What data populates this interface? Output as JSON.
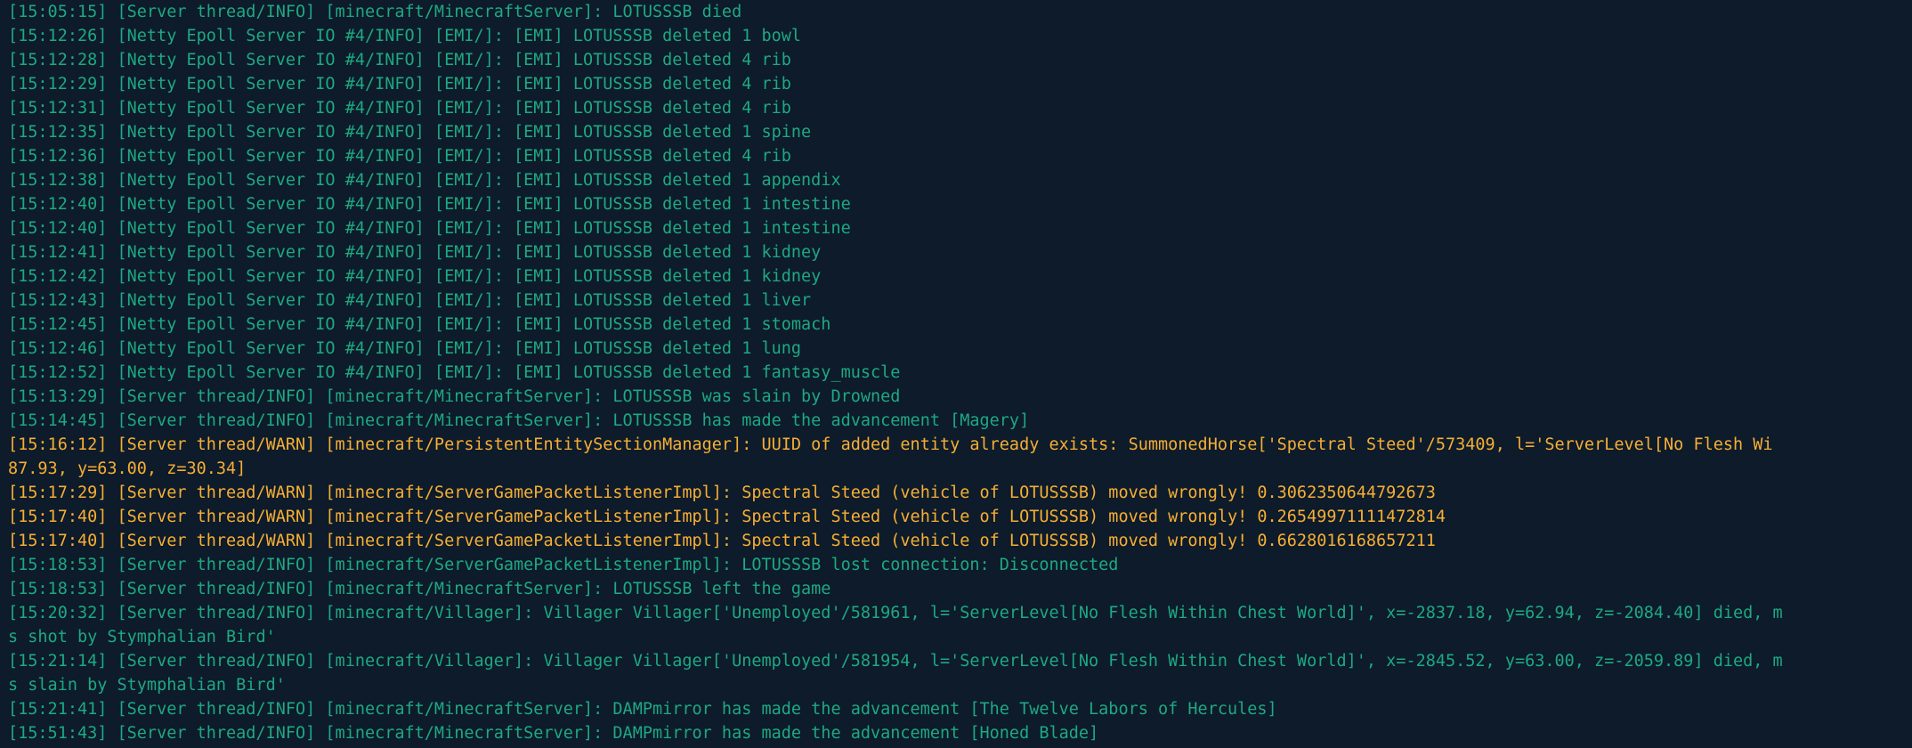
{
  "theme": {
    "background": "#0d1b2a",
    "info_color": "#1ea883",
    "warn_color": "#f6ae35"
  },
  "log": [
    {
      "level": "info",
      "text": "[15:05:15] [Server thread/INFO] [minecraft/MinecraftServer]: LOTUSSSB died"
    },
    {
      "level": "info",
      "text": "[15:12:26] [Netty Epoll Server IO #4/INFO] [EMI/]: [EMI] LOTUSSSB deleted 1 bowl"
    },
    {
      "level": "info",
      "text": "[15:12:28] [Netty Epoll Server IO #4/INFO] [EMI/]: [EMI] LOTUSSSB deleted 4 rib"
    },
    {
      "level": "info",
      "text": "[15:12:29] [Netty Epoll Server IO #4/INFO] [EMI/]: [EMI] LOTUSSSB deleted 4 rib"
    },
    {
      "level": "info",
      "text": "[15:12:31] [Netty Epoll Server IO #4/INFO] [EMI/]: [EMI] LOTUSSSB deleted 4 rib"
    },
    {
      "level": "info",
      "text": "[15:12:35] [Netty Epoll Server IO #4/INFO] [EMI/]: [EMI] LOTUSSSB deleted 1 spine"
    },
    {
      "level": "info",
      "text": "[15:12:36] [Netty Epoll Server IO #4/INFO] [EMI/]: [EMI] LOTUSSSB deleted 4 rib"
    },
    {
      "level": "info",
      "text": "[15:12:38] [Netty Epoll Server IO #4/INFO] [EMI/]: [EMI] LOTUSSSB deleted 1 appendix"
    },
    {
      "level": "info",
      "text": "[15:12:40] [Netty Epoll Server IO #4/INFO] [EMI/]: [EMI] LOTUSSSB deleted 1 intestine"
    },
    {
      "level": "info",
      "text": "[15:12:40] [Netty Epoll Server IO #4/INFO] [EMI/]: [EMI] LOTUSSSB deleted 1 intestine"
    },
    {
      "level": "info",
      "text": "[15:12:41] [Netty Epoll Server IO #4/INFO] [EMI/]: [EMI] LOTUSSSB deleted 1 kidney"
    },
    {
      "level": "info",
      "text": "[15:12:42] [Netty Epoll Server IO #4/INFO] [EMI/]: [EMI] LOTUSSSB deleted 1 kidney"
    },
    {
      "level": "info",
      "text": "[15:12:43] [Netty Epoll Server IO #4/INFO] [EMI/]: [EMI] LOTUSSSB deleted 1 liver"
    },
    {
      "level": "info",
      "text": "[15:12:45] [Netty Epoll Server IO #4/INFO] [EMI/]: [EMI] LOTUSSSB deleted 1 stomach"
    },
    {
      "level": "info",
      "text": "[15:12:46] [Netty Epoll Server IO #4/INFO] [EMI/]: [EMI] LOTUSSSB deleted 1 lung"
    },
    {
      "level": "info",
      "text": "[15:12:52] [Netty Epoll Server IO #4/INFO] [EMI/]: [EMI] LOTUSSSB deleted 1 fantasy_muscle"
    },
    {
      "level": "info",
      "text": "[15:13:29] [Server thread/INFO] [minecraft/MinecraftServer]: LOTUSSSB was slain by Drowned"
    },
    {
      "level": "info",
      "text": "[15:14:45] [Server thread/INFO] [minecraft/MinecraftServer]: LOTUSSSB has made the advancement [Magery]"
    },
    {
      "level": "warn",
      "text": "[15:16:12] [Server thread/WARN] [minecraft/PersistentEntitySectionManager]: UUID of added entity already exists: SummonedHorse['Spectral Steed'/573409, l='ServerLevel[No Flesh Wi"
    },
    {
      "level": "warn",
      "text": "87.93, y=63.00, z=30.34]"
    },
    {
      "level": "warn",
      "text": "[15:17:29] [Server thread/WARN] [minecraft/ServerGamePacketListenerImpl]: Spectral Steed (vehicle of LOTUSSSB) moved wrongly! 0.30623506447 92673"
    },
    {
      "level": "warn",
      "text": "[15:17:40] [Server thread/WARN] [minecraft/ServerGamePacketListenerImpl]: Spectral Steed (vehicle of LOTUSSSB) moved wrongly! 0.26549971111472814"
    },
    {
      "level": "warn",
      "text": "[15:17:40] [Server thread/WARN] [minecraft/ServerGamePacketListenerImpl]: Spectral Steed (vehicle of LOTUSSSB) moved wrongly! 0.6628016168657211"
    },
    {
      "level": "info",
      "text": "[15:18:53] [Server thread/INFO] [minecraft/ServerGamePacketListenerImpl]: LOTUSSSB lost connection: Disconnected"
    },
    {
      "level": "info",
      "text": "[15:18:53] [Server thread/INFO] [minecraft/MinecraftServer]: LOTUSSSB left the game"
    },
    {
      "level": "info",
      "text": "[15:20:32] [Server thread/INFO] [minecraft/Villager]: Villager Villager['Unemployed'/581961, l='ServerLevel[No Flesh Within Chest World]', x=-2837.18, y=62.94, z=-2084.40] died, m"
    },
    {
      "level": "info",
      "text": "s shot by Stymphalian Bird'"
    },
    {
      "level": "info",
      "text": "[15:21:14] [Server thread/INFO] [minecraft/Villager]: Villager Villager['Unemployed'/581954, l='ServerLevel[No Flesh Within Chest World]', x=-2845.52, y=63.00, z=-2059.89] died, m"
    },
    {
      "level": "info",
      "text": "s slain by Stymphalian Bird'"
    },
    {
      "level": "info",
      "text": "[15:21:41] [Server thread/INFO] [minecraft/MinecraftServer]: DAMPmirror has made the advancement [The Twelve Labors of Hercules]"
    },
    {
      "level": "info",
      "text": "[15:51:43] [Server thread/INFO] [minecraft/MinecraftServer]: DAMPmirror has made the advancement [Honed Blade]"
    }
  ]
}
